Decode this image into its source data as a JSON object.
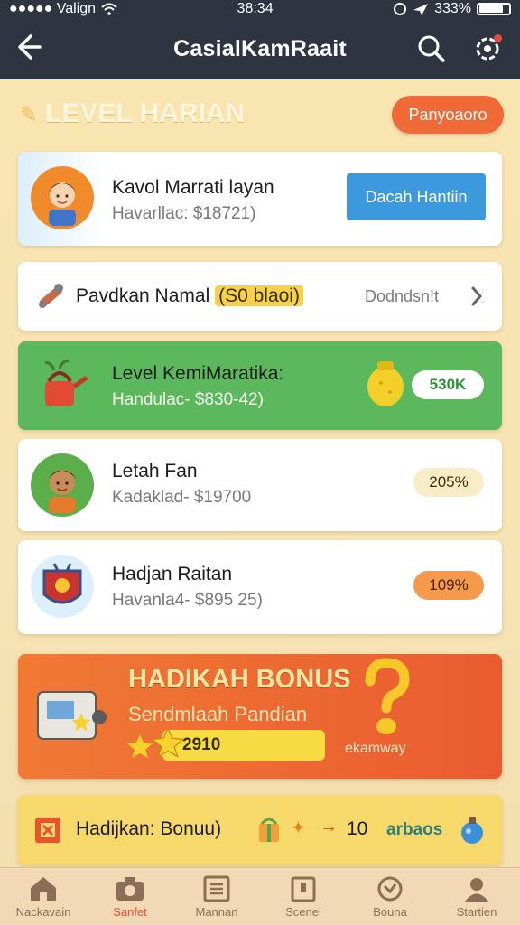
{
  "status_bar": {
    "carrier": "●●●●● Valign",
    "time": "38:34",
    "battery": "333%"
  },
  "header": {
    "title": "CasialKamRaait"
  },
  "section": {
    "title": "LEVEL HARIAN",
    "pill": "Panyoaoro"
  },
  "cards": [
    {
      "name": "Kavol Marrati layan",
      "sub": "Havarllac: $18721)",
      "button": "Dacah Hantiin"
    },
    {
      "name": "Pavdkan Namal",
      "highlight": "(S0 blaoi)",
      "action": "Dodndsn!t"
    },
    {
      "name": "Level KemiMaratika:",
      "sub": "Handulac- $830-42)",
      "badge": "530K"
    },
    {
      "name": "Letah Fan",
      "sub": "Kadaklad- $19700",
      "badge": "205%"
    },
    {
      "name": "Hadjan Raitan",
      "sub": "Havanla4- $895 25)",
      "badge": "109%"
    }
  ],
  "bonus": {
    "title": "HADIKAH BONUS",
    "subtitle": "Sendmlaah Pandian",
    "value": "2910",
    "link": "ekamway"
  },
  "bottom_card": {
    "label": "Hadijkan: Bonuu)",
    "count": "10",
    "link": "arbaos"
  },
  "tabs": [
    {
      "label": "Nackavain",
      "icon": "home-icon"
    },
    {
      "label": "Sanfet",
      "icon": "camera-icon",
      "active": true
    },
    {
      "label": "Mannan",
      "icon": "list-icon"
    },
    {
      "label": "Scenel",
      "icon": "clipboard-icon"
    },
    {
      "label": "Bouna",
      "icon": "clock-icon"
    },
    {
      "label": "Startien",
      "icon": "user-icon"
    }
  ],
  "colors": {
    "header_bg": "#2e3440",
    "accent_orange": "#ef6a36",
    "blue": "#3b99dc",
    "green_card": "#5cb85c",
    "bonus_orange": "#ea5b30",
    "yellow": "#f7d96b"
  }
}
